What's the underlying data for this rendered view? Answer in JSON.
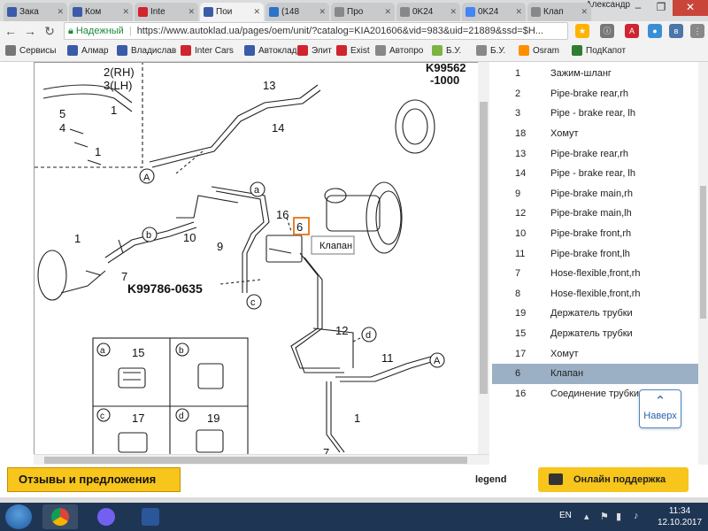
{
  "browser": {
    "tabs": [
      {
        "title": "Зака",
        "color": "#3a5ba8"
      },
      {
        "title": "Ком",
        "color": "#3a5ba8"
      },
      {
        "title": "Inte",
        "color": "#d0242f"
      },
      {
        "title": "Пои",
        "color": "#3a5ba8"
      },
      {
        "title": "(148",
        "color": "#2a74c9"
      },
      {
        "title": "Про",
        "color": "#888888"
      },
      {
        "title": "0K24",
        "color": "#888888"
      },
      {
        "title": "0K24",
        "color": "#4285f4"
      },
      {
        "title": "Клап",
        "color": "#888888"
      }
    ],
    "user_name": "Александр",
    "secure_label": "Надежный",
    "url": "https://www.autoklad.ua/pages/oem/unit/?catalog=KIA201606&vid=983&uid=21889&ssd=$H..."
  },
  "bookmarks": [
    {
      "label": "Сервисы",
      "color": "#777777"
    },
    {
      "label": "Алмар",
      "color": "#3a5ba8"
    },
    {
      "label": "Владислав",
      "color": "#3a5ba8"
    },
    {
      "label": "Inter Cars",
      "color": "#d0242f"
    },
    {
      "label": "Автоклад",
      "color": "#3a5ba8"
    },
    {
      "label": "Элит",
      "color": "#d0242f"
    },
    {
      "label": "Exist",
      "color": "#d0242f"
    },
    {
      "label": "Автопро",
      "color": "#888888"
    },
    {
      "label": "Б.У.",
      "color": "#7cb342"
    },
    {
      "label": "Б.У.",
      "color": "#888888"
    },
    {
      "label": "Osram",
      "color": "#ff8f00"
    },
    {
      "label": "ПодКапот",
      "color": "#2e7d32"
    }
  ],
  "diagram": {
    "labels": {
      "rh": "2(RH)",
      "lh": "3(LH)",
      "n1": "1",
      "n5": "5",
      "n4": "4",
      "n13": "13",
      "n14": "14",
      "k99562a": "K99562",
      "k99562b": "-1000",
      "a": "a",
      "b": "b",
      "n10": "10",
      "n16": "16",
      "n6": "6",
      "n9": "9",
      "n7": "7",
      "k99786": "K99786-0635",
      "c": "c",
      "n12": "12",
      "d": "d",
      "n11": "11",
      "A": "A",
      "n15": "15",
      "n17": "17",
      "n19": "19"
    },
    "tooltip": "Клапан"
  },
  "parts": [
    {
      "num": "1",
      "name": "Зажим-шланг"
    },
    {
      "num": "2",
      "name": "Pipe-brake rear,rh"
    },
    {
      "num": "3",
      "name": "Pipe - brake rear, lh"
    },
    {
      "num": "18",
      "name": "Хомут"
    },
    {
      "num": "13",
      "name": "Pipe-brake rear,rh"
    },
    {
      "num": "14",
      "name": "Pipe - brake rear, lh"
    },
    {
      "num": "9",
      "name": "Pipe-brake main,rh"
    },
    {
      "num": "12",
      "name": "Pipe-brake main,lh"
    },
    {
      "num": "10",
      "name": "Pipe-brake front,rh"
    },
    {
      "num": "11",
      "name": "Pipe-brake front,lh"
    },
    {
      "num": "7",
      "name": "Hose-flexible,front,rh"
    },
    {
      "num": "8",
      "name": "Hose-flexible,front,rh"
    },
    {
      "num": "19",
      "name": "Держатель трубки"
    },
    {
      "num": "15",
      "name": "Держатель трубки"
    },
    {
      "num": "17",
      "name": "Хомут"
    },
    {
      "num": "6",
      "name": "Клапан",
      "selected": true
    },
    {
      "num": "16",
      "name": "Соединение трубки"
    }
  ],
  "up_button": "Наверх",
  "footer": {
    "feedback": "Отзывы и предложения",
    "legend": "legend",
    "support": "Онлайн поддержка"
  },
  "taskbar": {
    "lang": "EN",
    "time": "11:34",
    "date": "12.10.2017"
  }
}
